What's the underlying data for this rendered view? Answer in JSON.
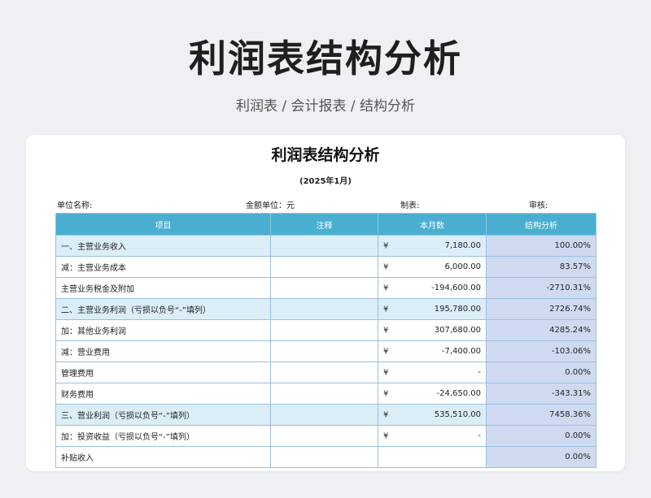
{
  "hero": {
    "title": "利润表结构分析",
    "subtitle": "利润表 / 会计报表 / 结构分析"
  },
  "sheet": {
    "title": "利润表结构分析",
    "period": "(2025年1月)",
    "meta": {
      "unit_name": "单位名称:",
      "currency_unit": "金额单位：元",
      "maker": "制表:",
      "reviewer": "审核:"
    },
    "columns": [
      "项目",
      "注释",
      "本月数",
      "结构分析"
    ],
    "currency_symbol": "¥",
    "rows": [
      {
        "item": "一、主营业务收入",
        "note": "",
        "has_yen": true,
        "amount": "7,180.00",
        "ratio": "100.00%",
        "highlight": true,
        "indent": 0
      },
      {
        "item": "减：主营业务成本",
        "note": "",
        "has_yen": true,
        "amount": "6,000.00",
        "ratio": "83.57%",
        "highlight": false,
        "indent": 1
      },
      {
        "item": "主营业务税金及附加",
        "note": "",
        "has_yen": true,
        "amount": "-194,600.00",
        "ratio": "-2710.31%",
        "highlight": false,
        "indent": 2
      },
      {
        "item": "二、主营业务利润（亏损以负号“-”填列）",
        "note": "",
        "has_yen": true,
        "amount": "195,780.00",
        "ratio": "2726.74%",
        "highlight": true,
        "indent": 0
      },
      {
        "item": "加：其他业务利润",
        "note": "",
        "has_yen": true,
        "amount": "307,680.00",
        "ratio": "4285.24%",
        "highlight": false,
        "indent": 1
      },
      {
        "item": "减：营业费用",
        "note": "",
        "has_yen": true,
        "amount": "-7,400.00",
        "ratio": "-103.06%",
        "highlight": false,
        "indent": 1
      },
      {
        "item": "管理费用",
        "note": "",
        "has_yen": true,
        "amount": "-",
        "ratio": "0.00%",
        "highlight": false,
        "indent": 2
      },
      {
        "item": "财务费用",
        "note": "",
        "has_yen": true,
        "amount": "-24,650.00",
        "ratio": "-343.31%",
        "highlight": false,
        "indent": 2
      },
      {
        "item": "三、营业利润（亏损以负号“-”填列）",
        "note": "",
        "has_yen": true,
        "amount": "535,510.00",
        "ratio": "7458.36%",
        "highlight": true,
        "indent": 0
      },
      {
        "item": "加：投资收益（亏损以负号“-”填列）",
        "note": "",
        "has_yen": true,
        "amount": "-",
        "ratio": "0.00%",
        "highlight": false,
        "indent": 1
      },
      {
        "item": "补贴收入",
        "note": "",
        "has_yen": false,
        "amount": "",
        "ratio": "0.00%",
        "highlight": false,
        "indent": 2
      }
    ]
  }
}
